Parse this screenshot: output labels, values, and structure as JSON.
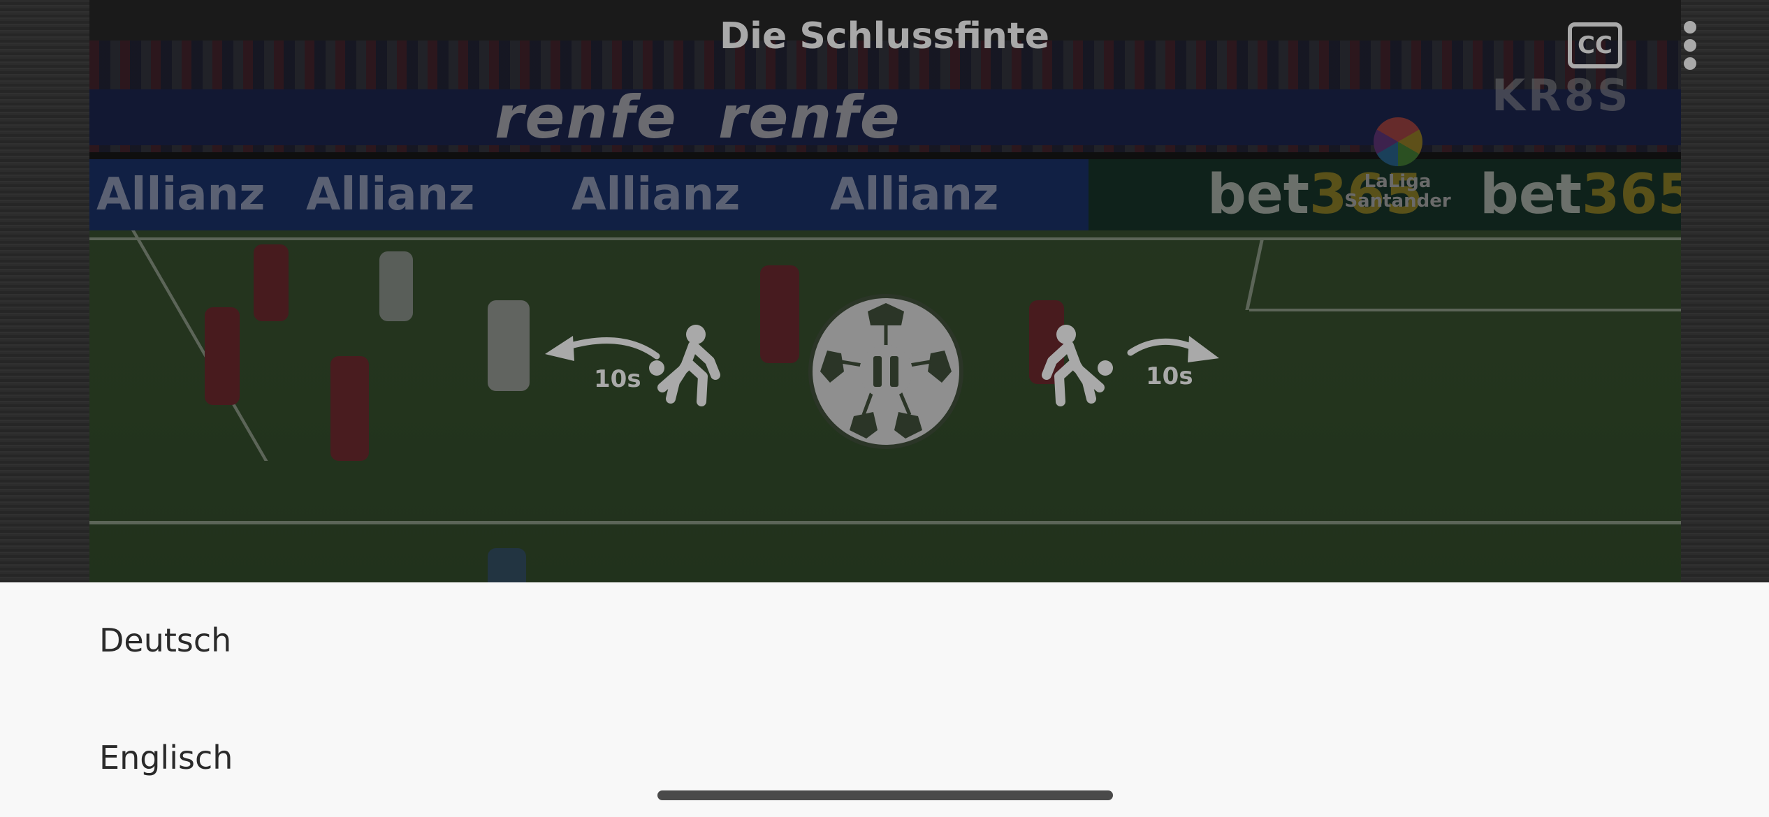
{
  "player": {
    "title": "Die Schlussfinte",
    "cc_label": "CC",
    "rewind_label": "10s",
    "forward_label": "10s"
  },
  "video_frame": {
    "banner_text": "renfe",
    "board_text": "Allianz",
    "bet_text_a": "bet",
    "bet_text_b": "365",
    "league_line1": "LaLiga",
    "league_line2": "Santander",
    "watermark": "KR8S"
  },
  "audio_languages": [
    {
      "label": "Deutsch"
    },
    {
      "label": "Englisch"
    }
  ],
  "colors": {
    "control_gray": "#a9a9a9",
    "sheet_background": "#f8f8f8",
    "text": "#2a2a2a"
  }
}
